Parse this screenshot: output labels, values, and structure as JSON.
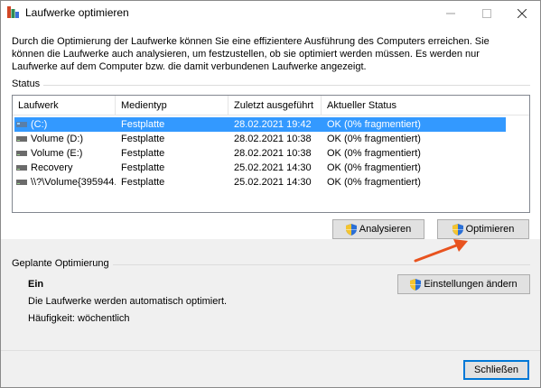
{
  "window": {
    "title": "Laufwerke optimieren"
  },
  "description": "Durch die Optimierung der Laufwerke können Sie eine effizientere Ausführung des Computers erreichen. Sie können die Laufwerke auch analysieren, um festzustellen, ob sie optimiert werden müssen. Es werden nur Laufwerke auf dem Computer bzw. die damit verbundenen Laufwerke angezeigt.",
  "status_section": {
    "label": "Status",
    "columns": [
      "Laufwerk",
      "Medientyp",
      "Zuletzt ausgeführt",
      "Aktueller Status"
    ],
    "rows": [
      {
        "drive": "(C:)",
        "media": "Festplatte",
        "last_run": "28.02.2021 19:42",
        "status": "OK (0% fragmentiert)"
      },
      {
        "drive": "Volume (D:)",
        "media": "Festplatte",
        "last_run": "28.02.2021 10:38",
        "status": "OK (0% fragmentiert)"
      },
      {
        "drive": "Volume (E:)",
        "media": "Festplatte",
        "last_run": "28.02.2021 10:38",
        "status": "OK (0% fragmentiert)"
      },
      {
        "drive": "Recovery",
        "media": "Festplatte",
        "last_run": "25.02.2021 14:30",
        "status": "OK (0% fragmentiert)"
      },
      {
        "drive": "\\\\?\\Volume{395944...",
        "media": "Festplatte",
        "last_run": "25.02.2021 14:30",
        "status": "OK (0% fragmentiert)"
      }
    ],
    "analyze_label": "Analysieren",
    "optimize_label": "Optimieren"
  },
  "scheduled_section": {
    "label": "Geplante Optimierung",
    "state": "Ein",
    "info": "Die Laufwerke werden automatisch optimiert.",
    "frequency": "Häufigkeit: wöchentlich",
    "change_settings_label": "Einstellungen ändern"
  },
  "footer": {
    "close_label": "Schließen"
  },
  "colors": {
    "selection": "#cce8ff",
    "shield_blue": "#2a6fd6",
    "shield_yellow": "#f4c430",
    "arrow": "#e8531f"
  }
}
